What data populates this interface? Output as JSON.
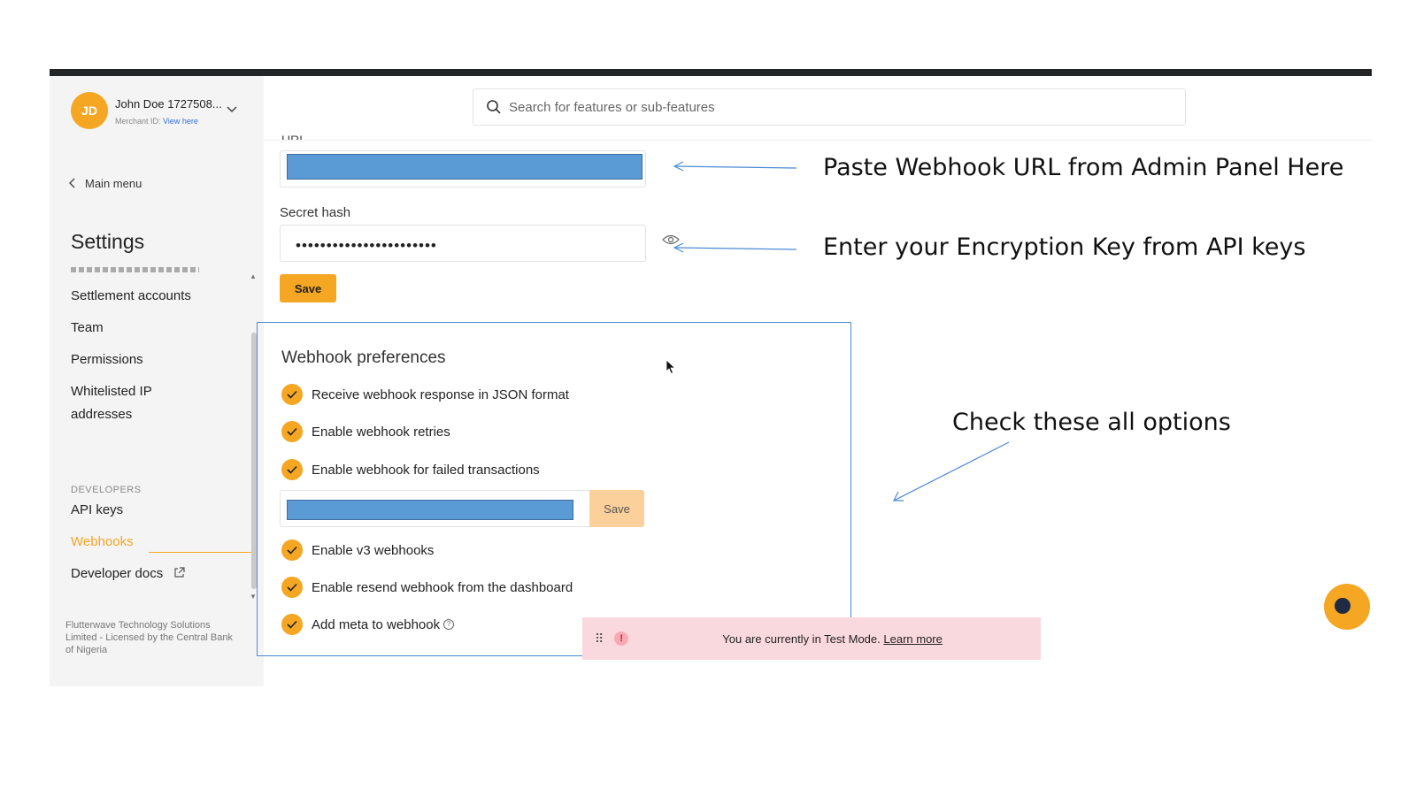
{
  "user": {
    "initials": "JD",
    "name": "John Doe 1727508...",
    "merchant_prefix": "Merchant ID: ",
    "merchant_link": "View here"
  },
  "search": {
    "placeholder": "Search for features or sub-features"
  },
  "sidebar": {
    "back_label": "Main menu",
    "title": "Settings",
    "items": [
      {
        "label": "Settlement accounts"
      },
      {
        "label": "Team"
      },
      {
        "label": "Permissions"
      },
      {
        "label": "Whitelisted IP addresses"
      }
    ],
    "section_developers": "DEVELOPERS",
    "dev_items": [
      {
        "label": "API keys"
      },
      {
        "label": "Webhooks",
        "active": true
      },
      {
        "label": "Developer docs"
      }
    ],
    "footer": "Flutterwave Technology Solutions Limited - Licensed by the Central Bank of Nigeria"
  },
  "form": {
    "url_label": "URL",
    "secret_label": "Secret hash",
    "secret_value": "•••••••••••••••••••••••",
    "save_label": "Save"
  },
  "preferences": {
    "title": "Webhook preferences",
    "options": [
      {
        "label": "Receive webhook response in JSON format",
        "checked": true
      },
      {
        "label": "Enable webhook retries",
        "checked": true
      },
      {
        "label": "Enable webhook for failed transactions",
        "checked": true
      },
      {
        "label": "Enable v3 webhooks",
        "checked": true
      },
      {
        "label": "Enable resend webhook from the dashboard",
        "checked": true
      },
      {
        "label": "Add meta to webhook",
        "checked": true
      }
    ],
    "inline_save_label": "Save"
  },
  "banner": {
    "message": "You are currently in Test Mode.",
    "link": "Learn more"
  },
  "annotations": {
    "url": "Paste Webhook URL from Admin Panel Here",
    "secret": "Enter your Encryption Key from API keys",
    "options": "Check these all options"
  },
  "colors": {
    "accent": "#f5a623",
    "highlight": "#5b9bd5",
    "annotation_arrow": "#4a8ad4",
    "banner_bg": "#fad9de"
  }
}
